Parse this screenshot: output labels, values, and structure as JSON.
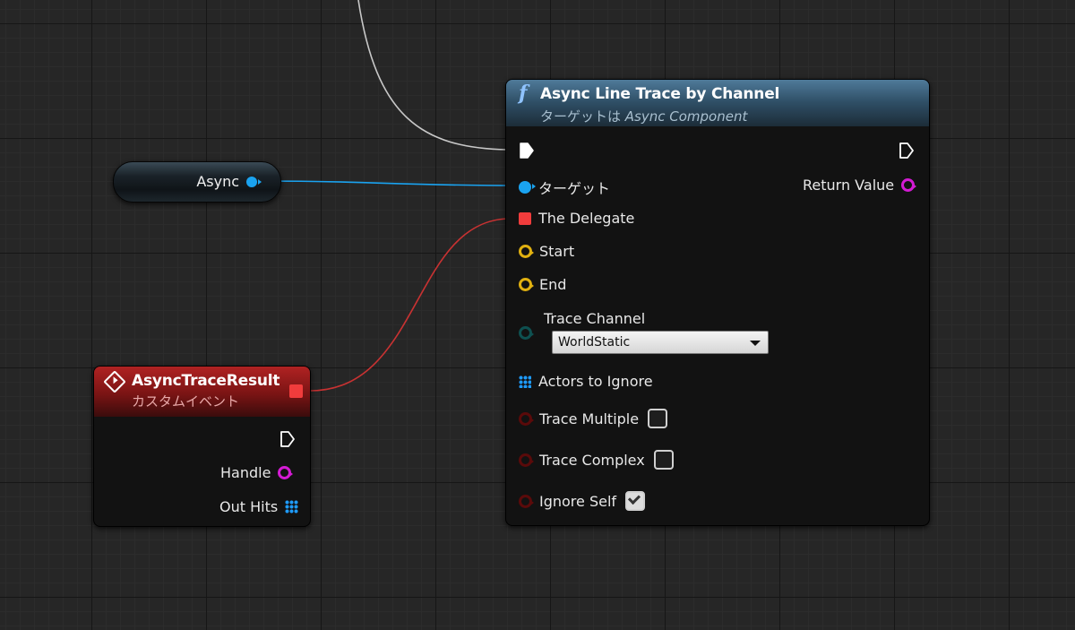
{
  "function_node": {
    "icon": "function-icon",
    "title": "Async Line Trace by Channel",
    "subtitle_prefix": "ターゲットは",
    "subtitle_target": "Async Component",
    "pins": {
      "target": "ターゲット",
      "return_value": "Return Value",
      "delegate": "The Delegate",
      "start": "Start",
      "end": "End",
      "trace_channel": "Trace Channel",
      "actors_to_ignore": "Actors to Ignore",
      "trace_multiple": "Trace Multiple",
      "trace_complex": "Trace Complex",
      "ignore_self": "Ignore Self"
    },
    "trace_channel_value": "WorldStatic",
    "trace_multiple_checked": false,
    "trace_complex_checked": false,
    "ignore_self_checked": true
  },
  "event_node": {
    "icon": "custom-event-icon",
    "title": "AsyncTraceResult",
    "subtitle": "カスタムイベント",
    "pins": {
      "handle": "Handle",
      "out_hits": "Out Hits"
    }
  },
  "variable_node": {
    "label": "Async"
  },
  "colors": {
    "exec_wire": "#c8c8c8",
    "object_wire": "#1aa3f0",
    "delegate_wire": "#c83232"
  }
}
